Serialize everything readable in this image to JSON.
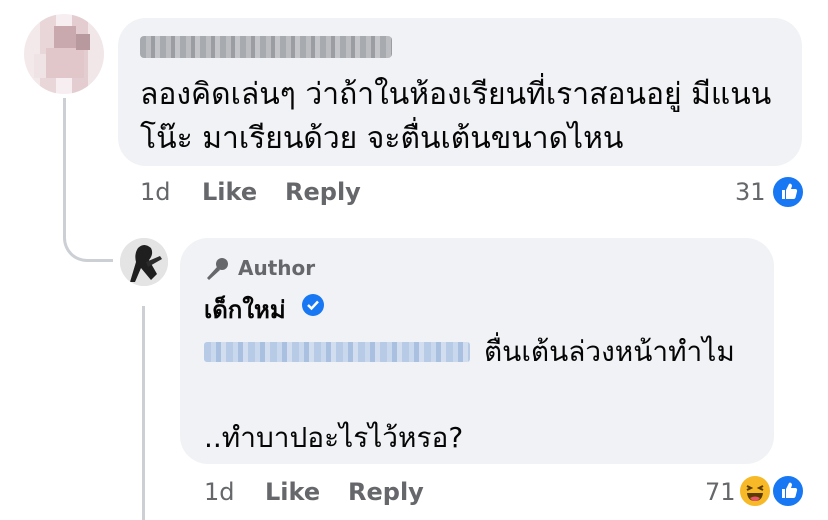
{
  "comment": {
    "text_line1": "ลองคิดเล่นๆ ว่าถ้าในห้องเรียนที่เราสอนอยู่ มีแนน",
    "text_line2": "โน๊ะ มาเรียนด้วย จะตื่นเต้นขนาดไหน",
    "time": "1d",
    "like_label": "Like",
    "reply_label": "Reply",
    "reaction_count": "31",
    "reaction_icons": [
      "like-icon"
    ]
  },
  "reply": {
    "author_tag": "Author",
    "author_name": "เด็กใหม่",
    "text_line1": "ตื่นเต้นล่วงหน้าทำไม",
    "text_line2": "..ทำบาปอะไรไว้หรอ?",
    "time": "1d",
    "like_label": "Like",
    "reply_label": "Reply",
    "reaction_count": "71",
    "reaction_icons": [
      "haha-icon",
      "like-icon"
    ]
  },
  "colors": {
    "bubble": "#f0f2f5",
    "meta": "#65676b",
    "like_blue": "#1877f2",
    "haha_yellow": "#f7b928",
    "thread_line": "#ccd0d5"
  }
}
